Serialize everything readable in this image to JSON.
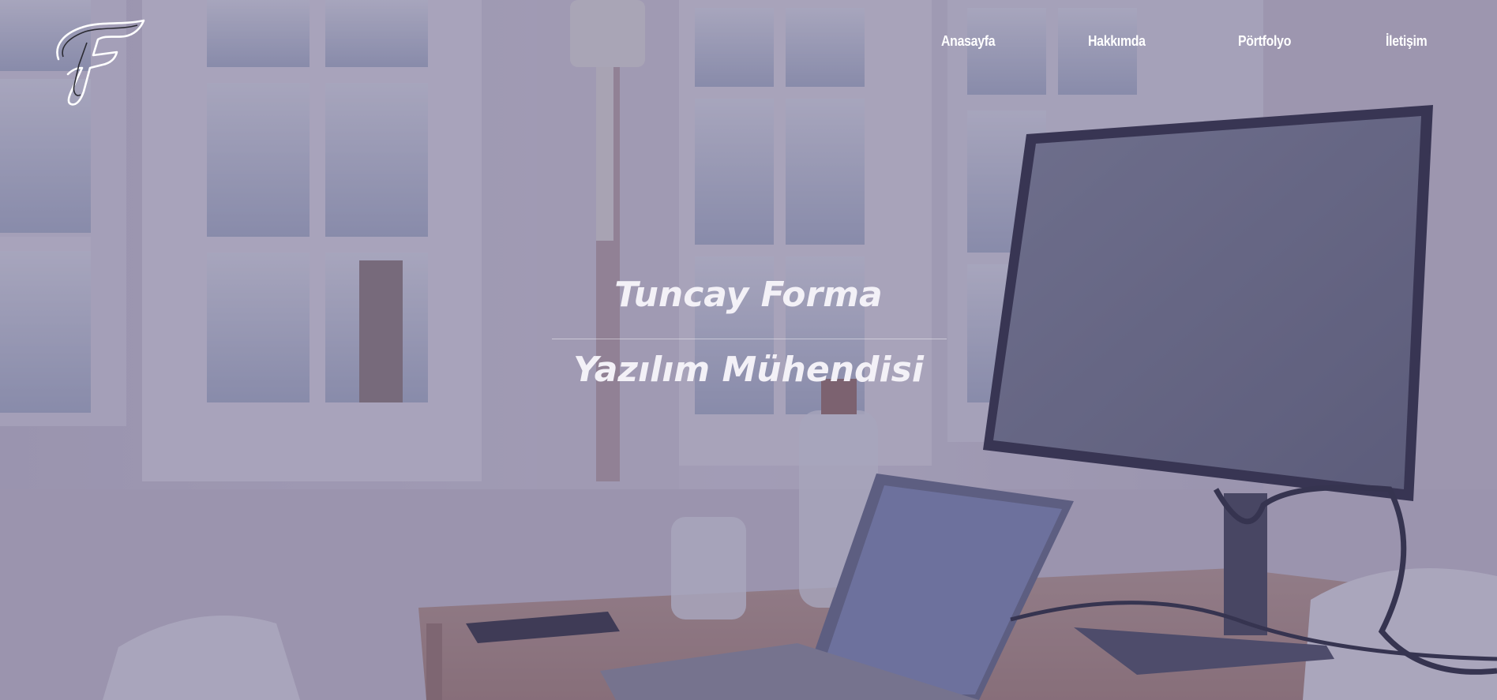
{
  "header": {
    "logo_letter": "F",
    "nav": [
      {
        "label": "Anasayfa"
      },
      {
        "label": "Hakkımda"
      },
      {
        "label": "Pörtfolyo"
      },
      {
        "label": "İletişim"
      }
    ]
  },
  "hero": {
    "name": "Tuncay Forma",
    "role": "Yazılım Mühendisi"
  },
  "colors": {
    "text": "#ffffff",
    "overlay": "#463e6e"
  }
}
